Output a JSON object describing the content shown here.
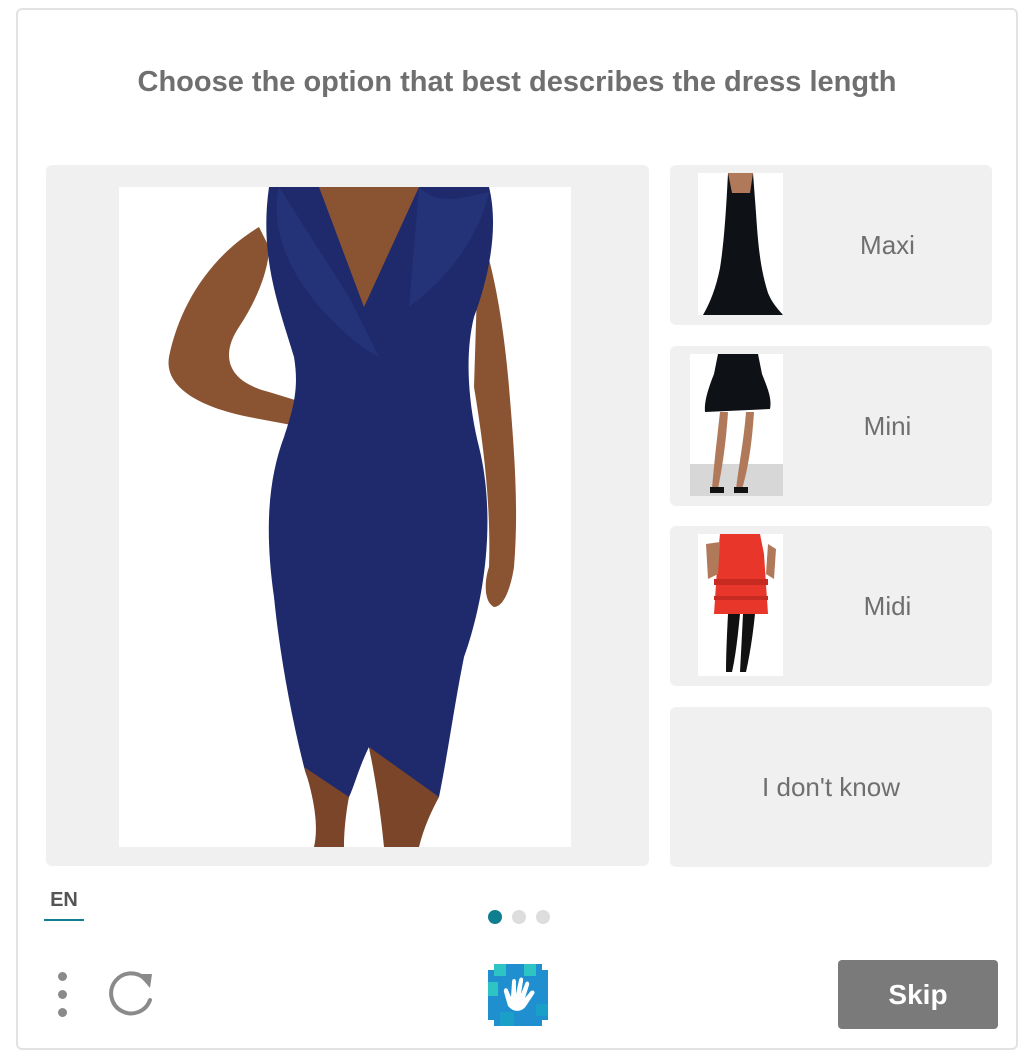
{
  "prompt": {
    "title": "Choose the option that best describes the dress length"
  },
  "options": [
    {
      "label": "Maxi",
      "thumb_icon": "maxi-dress-photo"
    },
    {
      "label": "Mini",
      "thumb_icon": "mini-dress-photo"
    },
    {
      "label": "Midi",
      "thumb_icon": "midi-dress-photo"
    },
    {
      "label": "I don't know"
    }
  ],
  "footer": {
    "language": "EN",
    "skip_label": "Skip",
    "pagination": {
      "total": 3,
      "active": 1
    },
    "icons": [
      "kebab-menu-icon",
      "refresh-icon",
      "hand-logo-icon"
    ]
  },
  "colors": {
    "accent": "#0f7f8f",
    "dress_navy": "#1e2a6b",
    "skip_bg": "#7a7a7a",
    "panel_bg": "#f0f0f0"
  }
}
